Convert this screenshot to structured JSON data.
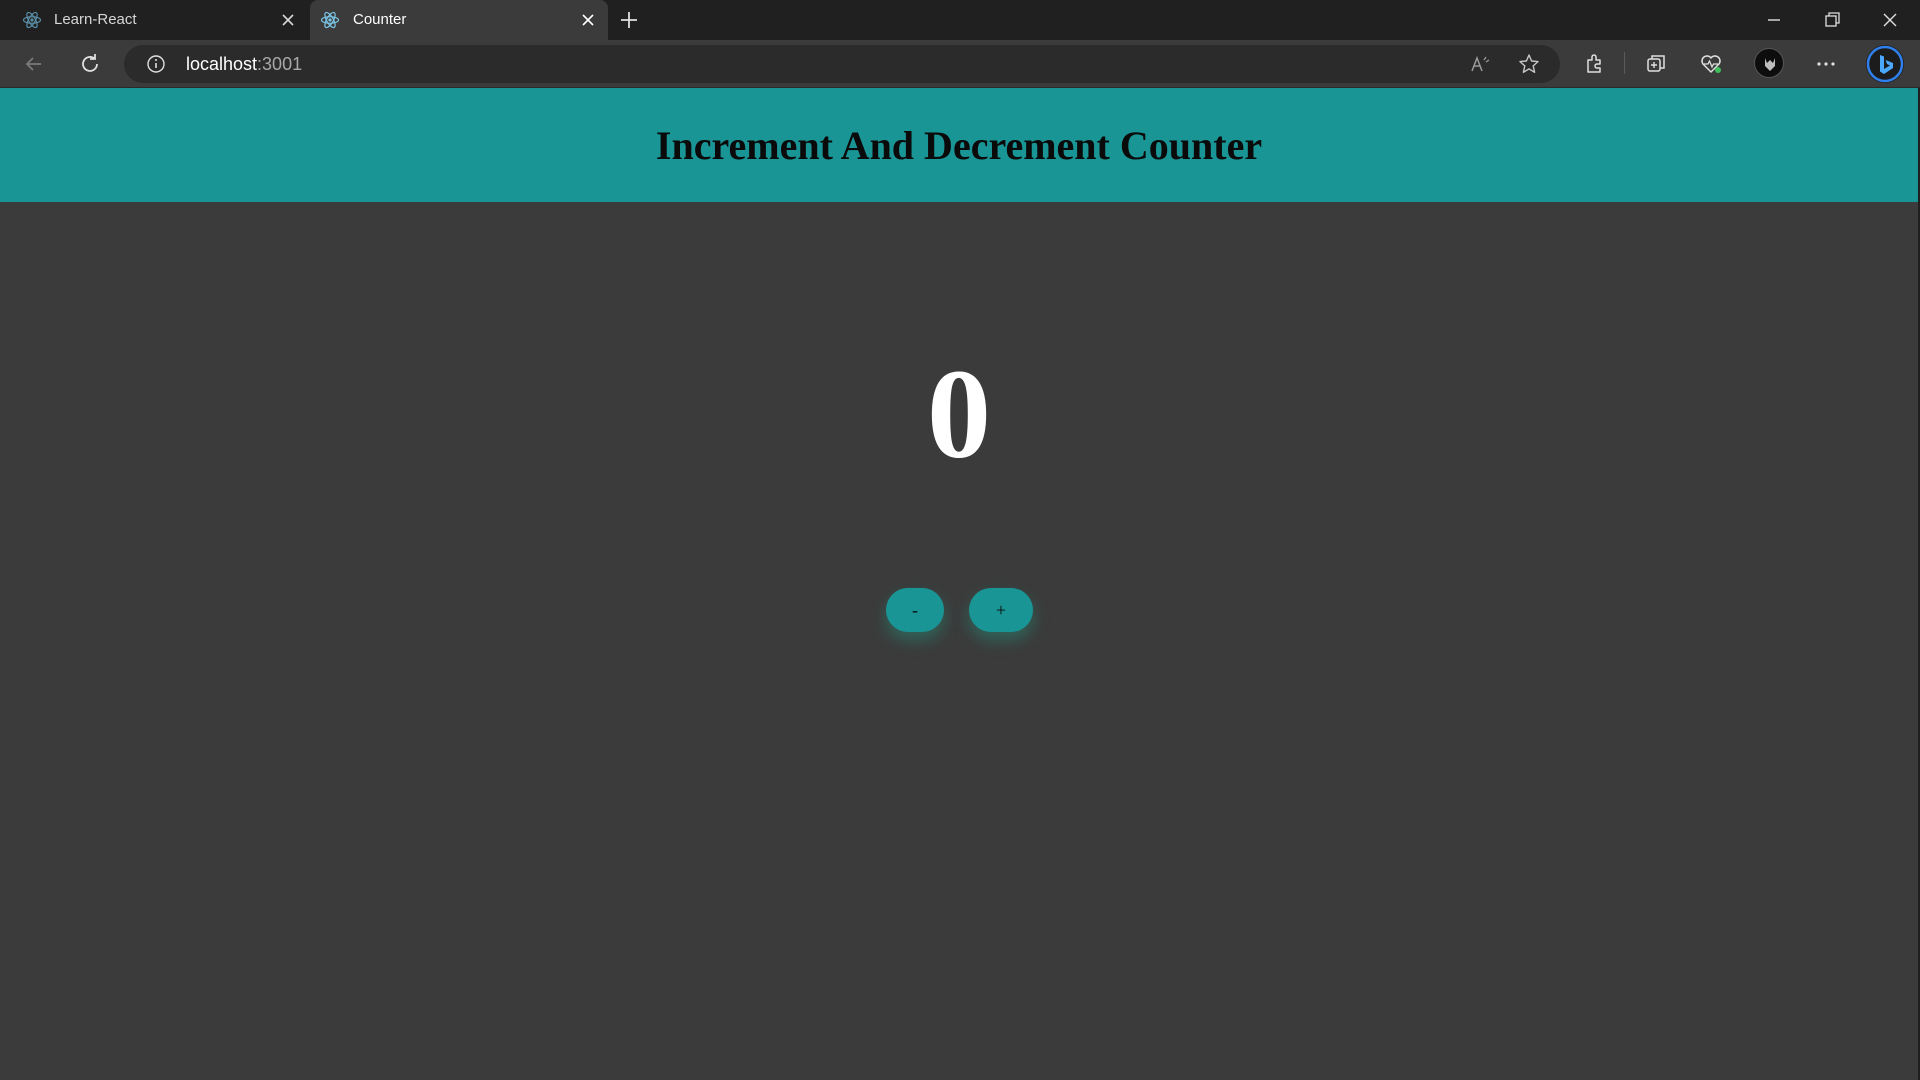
{
  "browser": {
    "tabs": [
      {
        "title": "Learn-React",
        "active": false,
        "icon": "react-icon"
      },
      {
        "title": "Counter",
        "active": true,
        "icon": "react-icon"
      }
    ],
    "address": {
      "host": "localhost",
      "port": ":3001"
    }
  },
  "page": {
    "heading": "Increment And Decrement Counter",
    "count": "0",
    "decrement_label": "-",
    "increment_label": "+"
  },
  "colors": {
    "accent": "#1a9596",
    "background": "#3b3b3b",
    "chrome": "#202020"
  }
}
